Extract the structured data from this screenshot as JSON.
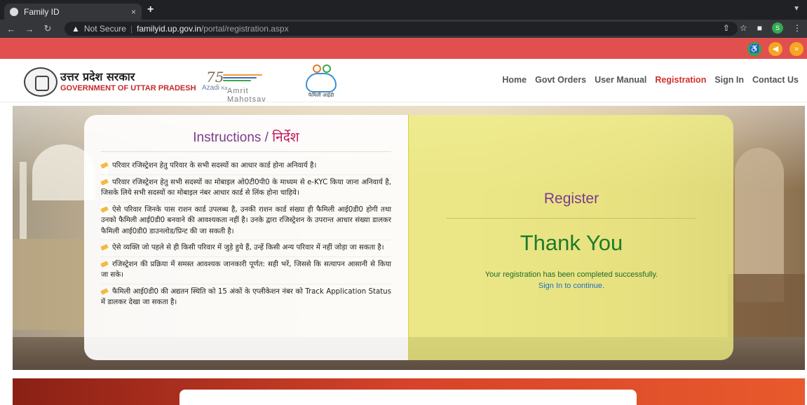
{
  "browser": {
    "tab_title": "Family ID",
    "tab_close": "×",
    "new_tab": "+",
    "security_label": "Not Secure",
    "url_host": "familyid.up.gov.in",
    "url_path": "/portal/registration.aspx",
    "profile_initial": "S"
  },
  "header": {
    "gov_name_hi": "उत्तर प्रदेश सरकार",
    "gov_name_en": "GOVERNMENT OF UTTAR PRADESH",
    "azadi_line1": "Azadi",
    "azadi_ka": "Ka",
    "azadi_line2": "Amrit Mahotsav",
    "family_logo_caption": "फैमिली आईडी"
  },
  "nav": {
    "items": [
      "Home",
      "Govt Orders",
      "User Manual",
      "Registration",
      "Sign In",
      "Contact Us"
    ],
    "active": "Registration"
  },
  "instructions": {
    "title_en": "Instructions / ",
    "title_hi": "निर्देश",
    "items": [
      "परिवार रजिस्ट्रेशन हेतु परिवार के सभी सदस्यों का आधार कार्ड होना अनिवार्य है।",
      "परिवार रजिस्ट्रेशन हेतु सभी सदस्यों का मोबाइल ओ0टी0पी0 के माध्यम से e-KYC किया जाना अनिवार्य है, जिसके लिये सभी सदस्यों का मोबाइल नंबर आधार कार्ड से लिंक होना चाहिये।",
      "ऐसे परिवार जिनके पास राशन कार्ड उपलब्ध है, उनकी राशन कार्ड संख्या ही फैमिली आई0डी0 होगी तथा उनको फैमिली आई0डी0 बनवाने की आवश्यकता नहीं है। उनके द्वारा रजिस्ट्रेशन के उपरान्त आधार संख्या डालकर फैमिली आई0डी0 डाउनलोड/प्रिन्ट की जा सकती है।",
      "ऐसे व्यक्ति जो पहले से ही किसी परिवार में जुड़े हुये हैं, उन्हें किसी अन्य परिवार में नहीं जोड़ा जा सकता है।",
      "रजिस्ट्रेशन की प्रक्रिया में समस्त आवश्यक जानकारी पूर्णत: सही भरें, जिससे कि सत्यापन आसानी से किया जा सके।",
      "फैमिली आई0डी0 की अद्यतन स्थिति को 15 अंकों के एप्लीकेशन नंबर को Track Application Status में डालकर देखा जा सकता है।"
    ]
  },
  "register": {
    "title": "Register",
    "thank_you": "Thank You",
    "success_message": "Your registration has been completed successfully.",
    "signin_prompt": "Sign In to continue."
  },
  "colors": {
    "accent_red": "#e14f4f",
    "active_nav": "#d32f2f",
    "heading_purple": "#7b3b8e",
    "thank_green": "#1e7b2a"
  }
}
